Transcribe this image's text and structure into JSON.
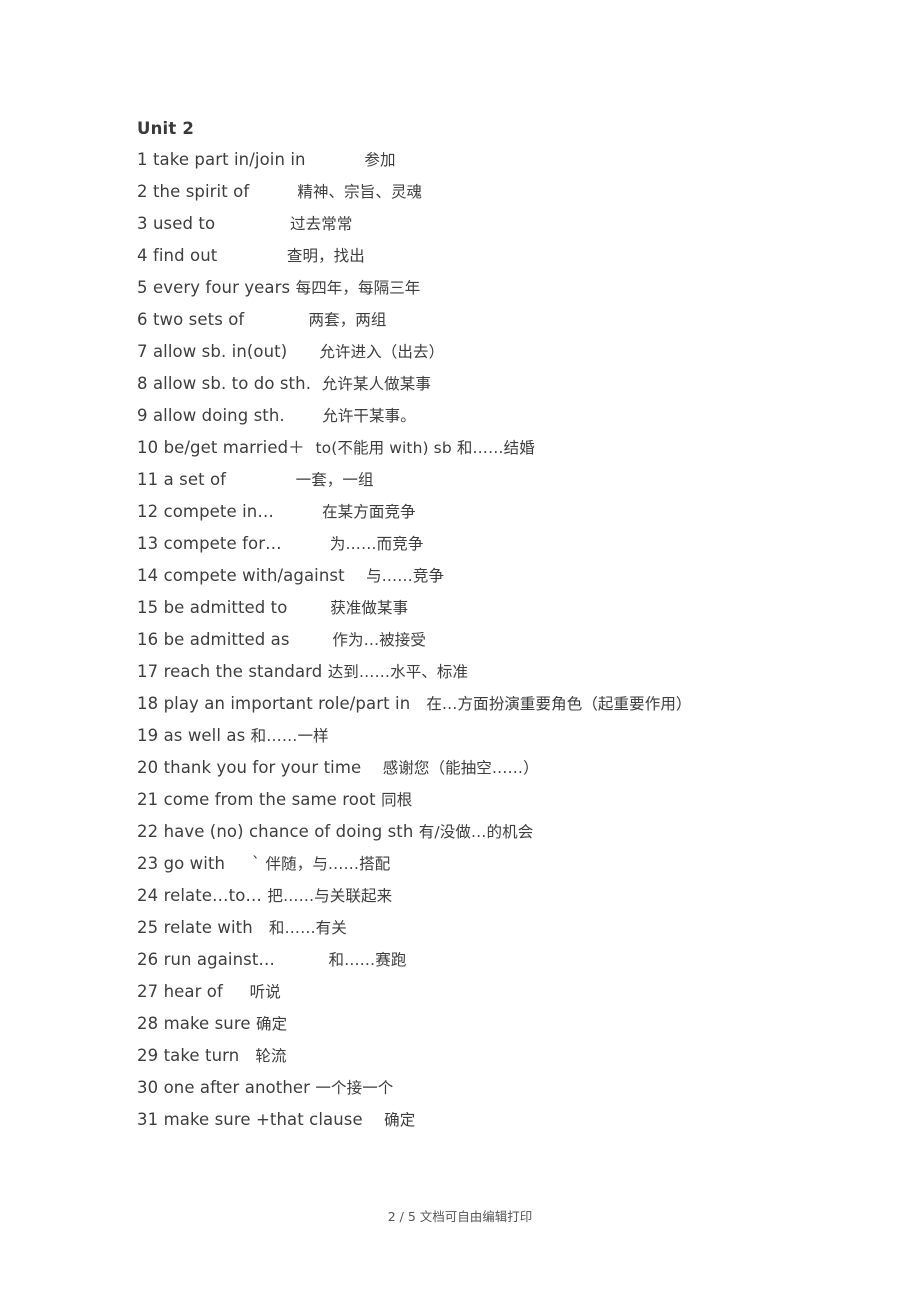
{
  "document": {
    "title": "Unit 2",
    "entries": [
      {
        "num": "1",
        "en": "take part in/join in",
        "gap": "          ",
        "cn": "参加"
      },
      {
        "num": "2",
        "en": "the spirit of",
        "gap": "        ",
        "cn": "精神、宗旨、灵魂"
      },
      {
        "num": "3",
        "en": "used to",
        "gap": "             ",
        "cn": "过去常常"
      },
      {
        "num": "4",
        "en": "find out",
        "gap": "            ",
        "cn": "查明，找出"
      },
      {
        "num": "5",
        "en": "every four years",
        "gap": "",
        "cn": "每四年，每隔三年"
      },
      {
        "num": "6",
        "en": "two sets of",
        "gap": "           ",
        "cn": "两套，两组"
      },
      {
        "num": "7",
        "en": "allow sb. in(out)",
        "gap": "     ",
        "cn": "允许进入（出去）"
      },
      {
        "num": "8",
        "en": "allow sb. to do sth.",
        "gap": " ",
        "cn": "允许某人做某事"
      },
      {
        "num": "9",
        "en": "allow doing sth.",
        "gap": "      ",
        "cn": "允许干某事。"
      },
      {
        "num": "10",
        "en": "be/get married＋",
        "gap": " ",
        "cn": "to(不能用 with) sb 和……结婚"
      },
      {
        "num": "11",
        "en": "a set of",
        "gap": "            ",
        "cn": "一套，一组"
      },
      {
        "num": "12",
        "en": "compete in…",
        "gap": "        ",
        "cn": "在某方面竞争"
      },
      {
        "num": "13",
        "en": "compete for…",
        "gap": "        ",
        "cn": "为……而竞争"
      },
      {
        "num": "14",
        "en": "compete with/against",
        "gap": "   ",
        "cn": "与……竞争"
      },
      {
        "num": "15",
        "en": "be admitted to",
        "gap": "       ",
        "cn": "获准做某事"
      },
      {
        "num": "16",
        "en": "be admitted as",
        "gap": "       ",
        "cn": "作为…被接受"
      },
      {
        "num": "17",
        "en": "reach the standard",
        "gap": "",
        "cn": "达到……水平、标准"
      },
      {
        "num": "18",
        "en": "play an important role/part in",
        "gap": "  ",
        "cn": "在…方面扮演重要角色（起重要作用）"
      },
      {
        "num": "19",
        "en": "as well as",
        "gap": "",
        "cn": "和……一样"
      },
      {
        "num": "20",
        "en": "thank you for your time",
        "gap": "   ",
        "cn": "感谢您（能抽空……）"
      },
      {
        "num": "21",
        "en": "come from the same root",
        "gap": "",
        "cn": "同根"
      },
      {
        "num": "22",
        "en": "have (no) chance of doing sth",
        "gap": "",
        "cn": "有/没做…的机会"
      },
      {
        "num": "23",
        "en": "go with",
        "gap": "     `",
        "cn": "伴随，与……搭配"
      },
      {
        "num": "24",
        "en": "relate…to…",
        "gap": "",
        "cn": "把……与关联起来"
      },
      {
        "num": "25",
        "en": "relate with",
        "gap": "  ",
        "cn": "和……有关"
      },
      {
        "num": "26",
        "en": "run against…",
        "gap": "         ",
        "cn": "和……赛跑"
      },
      {
        "num": "27",
        "en": "hear of",
        "gap": "    ",
        "cn": "听说"
      },
      {
        "num": "28",
        "en": "make sure",
        "gap": "",
        "cn": "确定"
      },
      {
        "num": "29",
        "en": "take turn",
        "gap": "  ",
        "cn": "轮流"
      },
      {
        "num": "30",
        "en": "one after another",
        "gap": "",
        "cn": "一个接一个"
      },
      {
        "num": "31",
        "en": "make sure +that clause",
        "gap": "   ",
        "cn": "确定"
      }
    ]
  },
  "footer": {
    "text": "2 / 5 文档可自由编辑打印"
  }
}
